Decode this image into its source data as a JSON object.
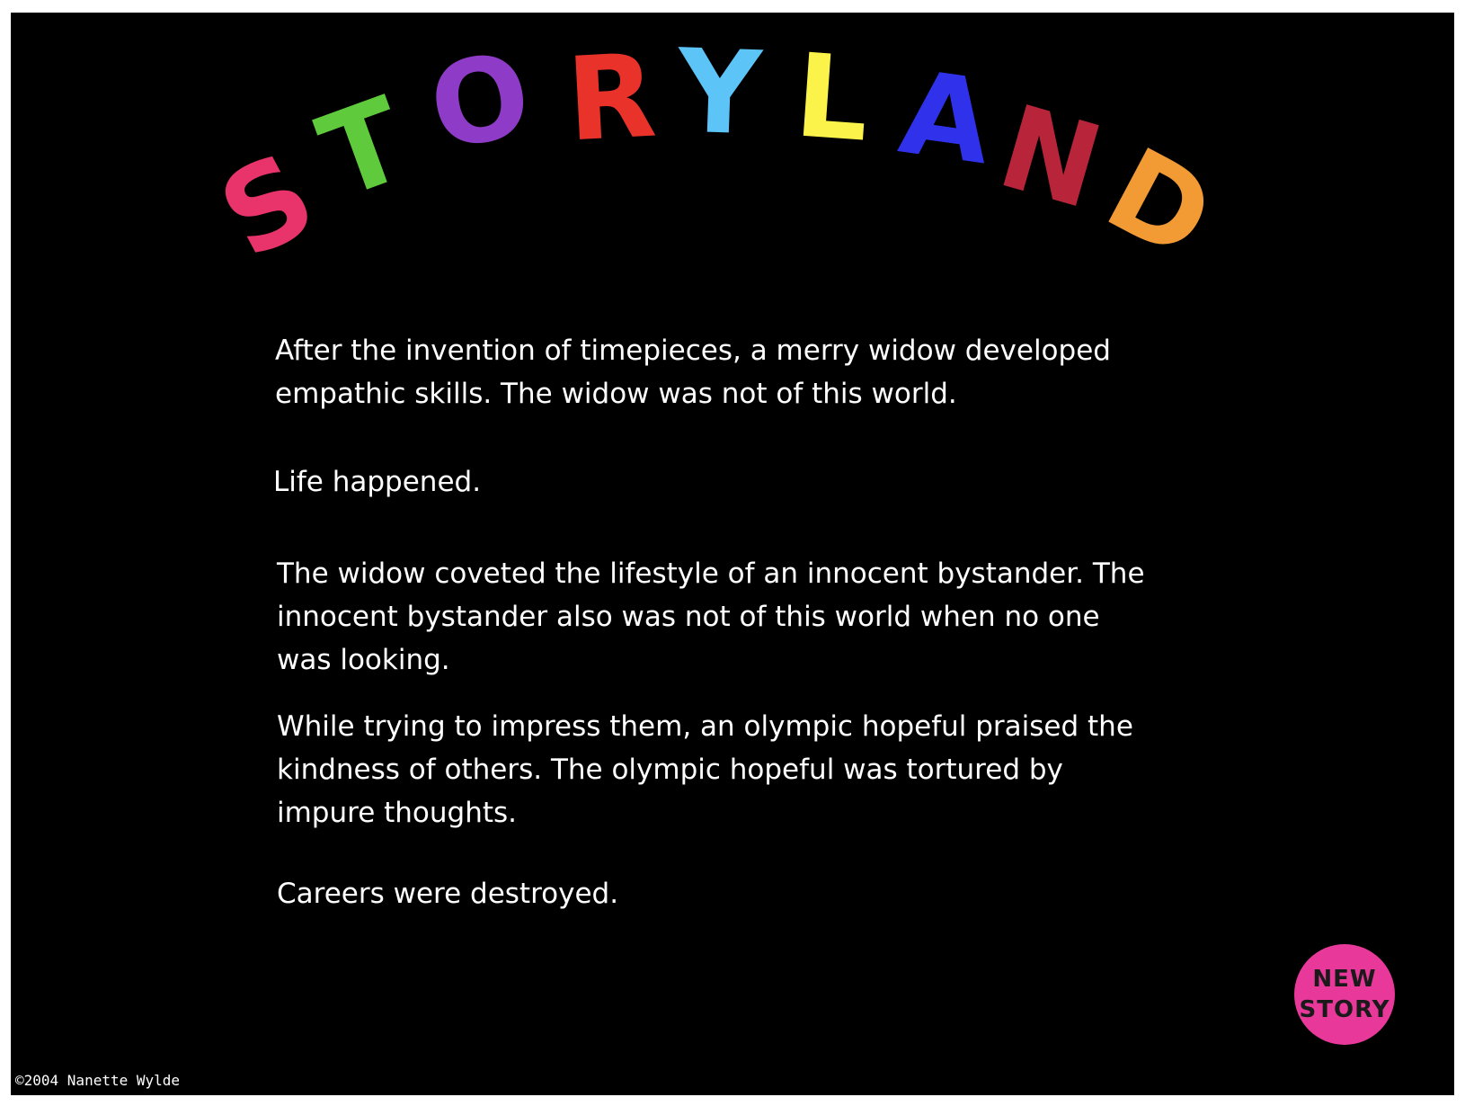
{
  "title": {
    "letters": [
      {
        "char": "S",
        "color": "#e8346a"
      },
      {
        "char": "T",
        "color": "#5fcb3c"
      },
      {
        "char": "O",
        "color": "#8e3cc7"
      },
      {
        "char": "R",
        "color": "#e8322a"
      },
      {
        "char": "Y",
        "color": "#5cc4f6"
      },
      {
        "char": "L",
        "color": "#fbf34a"
      },
      {
        "char": "A",
        "color": "#2f32ea"
      },
      {
        "char": "N",
        "color": "#b8243a"
      },
      {
        "char": "D",
        "color": "#f29a34"
      }
    ]
  },
  "story": {
    "paragraph_1": "After the invention of timepieces, a merry widow developed empathic skills. The widow was not of this world.",
    "paragraph_2": "Life happened.",
    "paragraph_3": "The widow coveted the lifestyle of an innocent bystander. The innocent bystander also was not of this world when no one was looking.",
    "paragraph_4": "While trying to impress them, an olympic hopeful praised the kindness of others. The olympic hopeful was tortured by impure thoughts.",
    "paragraph_5": "Careers were destroyed."
  },
  "new_story_button": {
    "line_1": "NEW",
    "line_2": "STORY",
    "color": "#e8399a"
  },
  "footer": {
    "copyright": "©2004 Nanette Wylde"
  }
}
